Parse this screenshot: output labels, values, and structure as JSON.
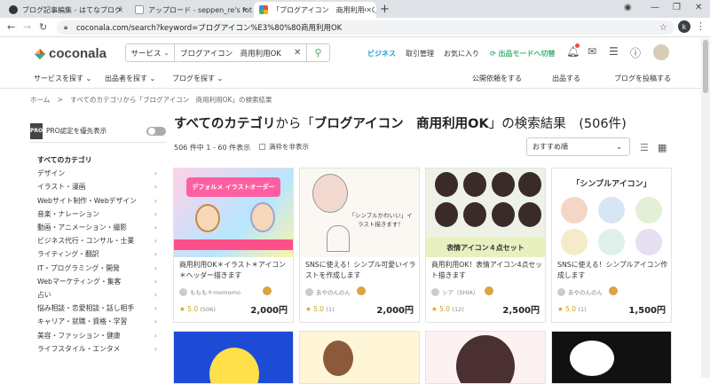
{
  "browser": {
    "tabs": [
      {
        "title": "ブログ記事編集 - はてなブログ",
        "active": false
      },
      {
        "title": "アップロード - seppen_re's fotolife",
        "active": false
      },
      {
        "title": "「ブログアイコン　商用利用OK」から",
        "active": true
      }
    ],
    "url": "coconala.com/search?keyword=ブログアイコン%E3%80%80商用利用OK",
    "profile_initial": "k"
  },
  "header": {
    "logo": "coconala",
    "search_category": "サービス",
    "search_keyword": "ブログアイコン　商用利用OK",
    "links": {
      "business": "ビジネス",
      "transactions": "取引管理",
      "favorites": "お気に入り",
      "switch_mode": "出品モードへ切替"
    }
  },
  "subnav": {
    "find_service": "サービスを探す",
    "find_seller": "出品者を探す",
    "find_blog": "ブログを探す",
    "post_request": "公開依頼をする",
    "sell": "出品する",
    "post_blog": "ブログを投稿する"
  },
  "breadcrumb": {
    "home": "ホーム",
    "sep": ">",
    "current": "すべてのカテゴリから「ブログアイコン　商用利用OK」の検索結果"
  },
  "sidebar": {
    "pro_label": "PRO認定を優先表示",
    "pro_badge": "PRO",
    "categories": [
      "すべてのカテゴリ",
      "デザイン",
      "イラスト・漫画",
      "Webサイト制作・Webデザイン",
      "音楽・ナレーション",
      "動画・アニメーション・撮影",
      "ビジネス代行・コンサル・士業",
      "ライティング・翻訳",
      "IT・プログラミング・開発",
      "Webマーケティング・集客",
      "占い",
      "悩み相談・恋愛相談・話し相手",
      "キャリア・就職・資格・学習",
      "美容・ファッション・健康",
      "ライフスタイル・エンタメ"
    ]
  },
  "results": {
    "title_category": "すべてのカテゴリ",
    "title_mid": "から「",
    "title_keyword": "ブログアイコン　商用利用OK",
    "title_tail": "」の検索結果　(506件)",
    "count": "506 件中 1 - 60 件表示",
    "hide_soldout": "満枠を非表示",
    "sort": "おすすめ順"
  },
  "cards": [
    {
      "title": "商用利用OK＊イラスト＊アイコン＊ヘッダー描きます",
      "seller": "ももも＊momomo",
      "rating": "★ 5.0",
      "reviews": "(506)",
      "price": "2,000円",
      "thumb_text": "デフォルメ イラストオーダー"
    },
    {
      "title": "SNSに使える！シンプル可愛いイラストを作成します",
      "seller": "あやのんのん",
      "rating": "★ 5.0",
      "reviews": "(1)",
      "price": "2,000円",
      "thumb_text": "「シンプルかわいい」イラスト描きます！"
    },
    {
      "title": "商用利用OK！表情アイコン4点セット描きます",
      "seller": "シア（SHIA）",
      "rating": "★ 5.0",
      "reviews": "(12)",
      "price": "2,500円",
      "thumb_text": "表情アイコン４点セット"
    },
    {
      "title": "SNSに使える！シンプルアイコン作成します",
      "seller": "あやのんのん",
      "rating": "★ 5.0",
      "reviews": "(1)",
      "price": "1,500円",
      "thumb_text": "「シンプルアイコン」"
    }
  ]
}
